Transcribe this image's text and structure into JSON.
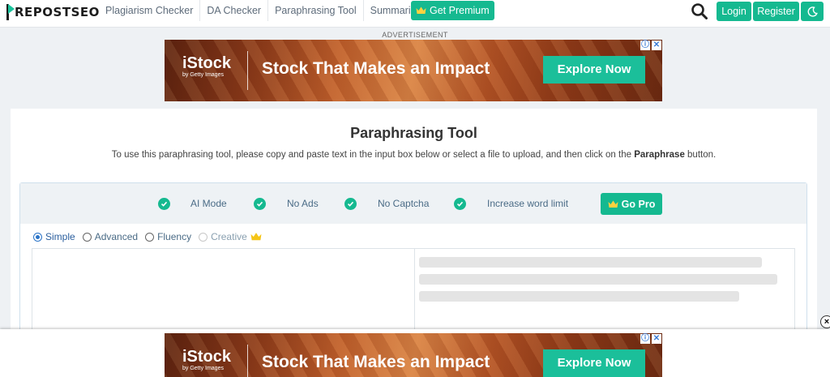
{
  "header": {
    "logo_text": "REPOSTSEO",
    "nav": [
      "Plagiarism Checker",
      "DA Checker",
      "Paraphrasing Tool",
      "Summarizer"
    ],
    "premium_label": "Get Premium",
    "login_label": "Login",
    "register_label": "Register"
  },
  "ads": {
    "label": "ADVERTISEMENT",
    "brand": "iStock",
    "brand_sub": "by Getty Images",
    "headline": "Stock That Makes an Impact",
    "cta": "Explore Now",
    "info_glyph": "ⓘ",
    "close_glyph": "✕"
  },
  "tool": {
    "title": "Paraphrasing Tool",
    "subtitle_pre": "To use this paraphrasing tool, please copy and paste text in the input box below or select a file to upload, and then click on the ",
    "subtitle_bold": "Paraphrase",
    "subtitle_post": " button.",
    "features": [
      "AI Mode",
      "No Ads",
      "No Captcha",
      "Increase word limit"
    ],
    "go_pro_label": "Go Pro",
    "modes": [
      {
        "label": "Simple",
        "selected": true
      },
      {
        "label": "Advanced",
        "selected": false
      },
      {
        "label": "Fluency",
        "selected": false
      },
      {
        "label": "Creative",
        "selected": false,
        "premium": true
      }
    ]
  },
  "sticky_close_glyph": "×",
  "colors": {
    "accent": "#15b990",
    "link": "#4a6b86",
    "selected_radio": "#2b74c7"
  },
  "icons": [
    "search-icon",
    "moon-icon",
    "crown-icon",
    "check-icon",
    "close-icon",
    "info-icon"
  ]
}
